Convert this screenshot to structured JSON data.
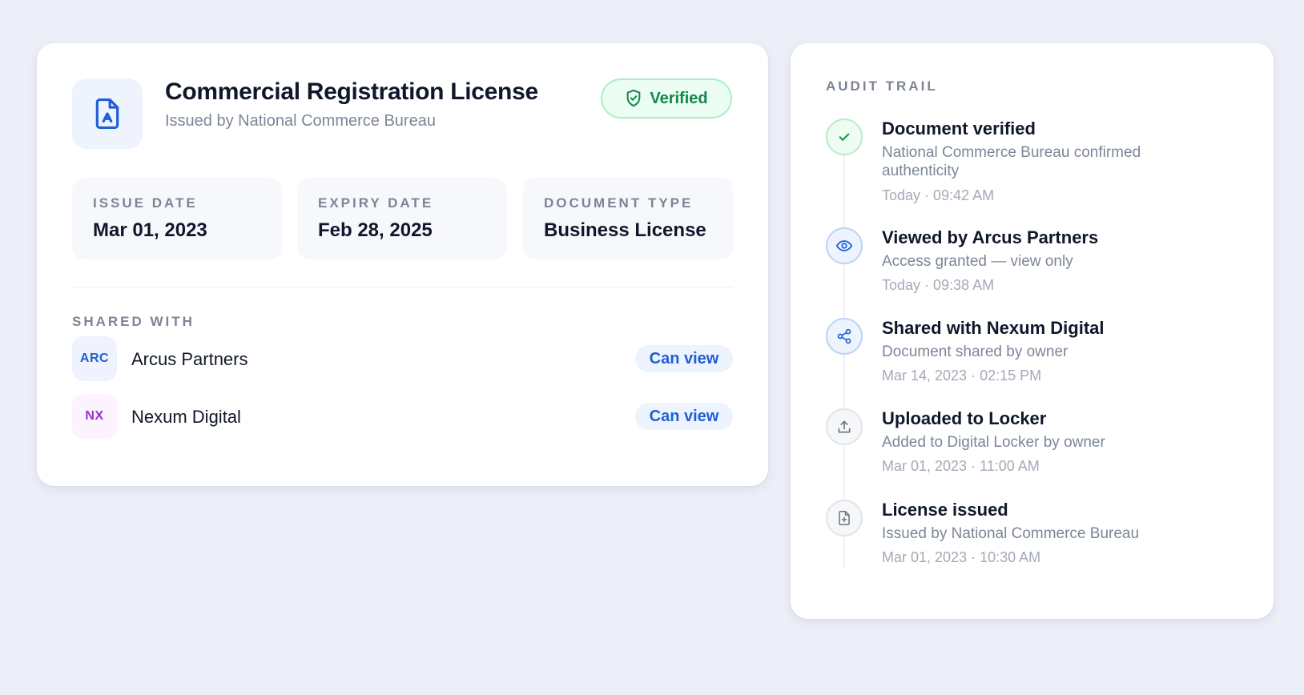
{
  "document": {
    "title": "Commercial Registration License",
    "issuer": "Issued by National Commerce Bureau",
    "status": "Verified",
    "icon": "file-badge-icon",
    "status_icon": "shield-check-icon",
    "meta": [
      {
        "label": "ISSUE DATE",
        "value": "Mar 01, 2023"
      },
      {
        "label": "EXPIRY DATE",
        "value": "Feb 28, 2025"
      },
      {
        "label": "DOCUMENT TYPE",
        "value": "Business License"
      }
    ]
  },
  "shared": {
    "label": "SHARED WITH",
    "parties": [
      {
        "initials": "ARC",
        "name": "Arcus Partners",
        "permission": "Can view",
        "avatar_bg": "#eef3fe",
        "avatar_color": "#1f5fd6"
      },
      {
        "initials": "NX",
        "name": "Nexum Digital",
        "permission": "Can view",
        "avatar_bg": "#fbf3fe",
        "avatar_color": "#9b2fd6"
      }
    ]
  },
  "audit": {
    "label": "AUDIT TRAIL",
    "events": [
      {
        "title": "Document verified",
        "description": "National Commerce Bureau confirmed authenticity",
        "time": "Today · 09:42 AM",
        "icon": "check-icon"
      },
      {
        "title": "Viewed by Arcus Partners",
        "description": "Access granted — view only",
        "time": "Today · 09:38 AM",
        "icon": "eye-icon"
      },
      {
        "title": "Shared with Nexum Digital",
        "description": "Document shared by owner",
        "time": "Mar 14, 2023 · 02:15 PM",
        "icon": "share-icon"
      },
      {
        "title": "Uploaded to Locker",
        "description": "Added to Digital Locker by owner",
        "time": "Mar 01, 2023 · 11:00 AM",
        "icon": "upload-icon"
      },
      {
        "title": "License issued",
        "description": "Issued by National Commerce Bureau",
        "time": "Mar 01, 2023 · 10:30 AM",
        "icon": "file-plus-icon"
      }
    ]
  },
  "colors": {
    "accent": "#1f5fd6",
    "success": "#14874a",
    "page_bg": "#eceef8"
  }
}
